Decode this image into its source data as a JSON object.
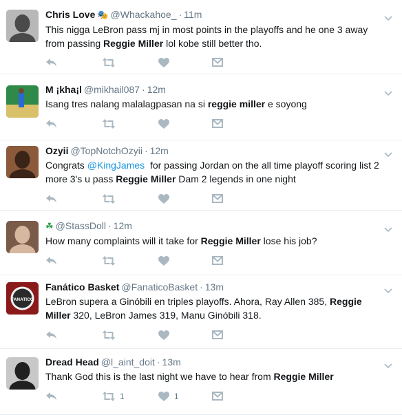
{
  "tweets": [
    {
      "fullname": "Chris Love",
      "emoji": "🎭",
      "username": "@Whackahoe_",
      "time": "11m",
      "segments": [
        {
          "t": "This nigga LeBron pass mj in most points in the playoffs and he one 3 away from passing "
        },
        {
          "t": "Reggie Miller",
          "b": true
        },
        {
          "t": " lol kobe still better tho."
        }
      ],
      "retweets": "",
      "likes": "",
      "avatar_colors": [
        "#4a4a4a",
        "#b8b8b8"
      ]
    },
    {
      "fullname": "M ¡kha¡l",
      "emoji": "",
      "username": "@mikhail087",
      "time": "12m",
      "segments": [
        {
          "t": "Isang tres nalang malalagpasan na si "
        },
        {
          "t": "reggie miller",
          "b": true
        },
        {
          "t": " e soyong"
        }
      ],
      "retweets": "",
      "likes": "",
      "avatar_colors": [
        "#2f8a4a",
        "#d9c16a"
      ]
    },
    {
      "fullname": "Ozyii",
      "emoji": "",
      "username": "@TopNotchOzyii",
      "time": "12m",
      "segments": [
        {
          "t": "Congrats "
        },
        {
          "t": "@KingJames",
          "m": true
        },
        {
          "t": "  for passing Jordan on the all time playoff scoring list 2 more 3's u pass "
        },
        {
          "t": "Reggie Miller",
          "b": true
        },
        {
          "t": " Dam 2 legends in one night"
        }
      ],
      "retweets": "",
      "likes": "",
      "avatar_colors": [
        "#3a2418",
        "#8a5a3a"
      ]
    },
    {
      "fullname": "",
      "emoji": "☘",
      "username": "@StassDoll",
      "time": "12m",
      "segments": [
        {
          "t": "How many complaints will it take for "
        },
        {
          "t": "Reggie Miller",
          "b": true
        },
        {
          "t": " lose his job?"
        }
      ],
      "retweets": "",
      "likes": "",
      "avatar_colors": [
        "#d6b8a0",
        "#7a5a48"
      ]
    },
    {
      "fullname": "Fanático Basket",
      "emoji": "",
      "username": "@FanaticoBasket",
      "time": "13m",
      "segments": [
        {
          "t": "LeBron supera a Ginóbili en triples playoffs. Ahora, Ray Allen 385, "
        },
        {
          "t": "Reggie Miller",
          "b": true
        },
        {
          "t": " 320, LeBron James 319, Manu Ginóbili 318."
        }
      ],
      "retweets": "",
      "likes": "",
      "avatar_colors": [
        "#8a1a1a",
        "#2a2a2a"
      ],
      "avatar_text": "FANATICO"
    },
    {
      "fullname": "Dread Head",
      "emoji": "",
      "username": "@l_aint_doit",
      "time": "13m",
      "segments": [
        {
          "t": "Thank God this is the last night we have to hear from "
        },
        {
          "t": "Reggie Miller",
          "b": true
        }
      ],
      "retweets": "1",
      "likes": "1",
      "avatar_colors": [
        "#202020",
        "#c8c8c8"
      ]
    }
  ],
  "colors": {
    "action_icon": "#aab8c2",
    "secondary_text": "#657786",
    "mention": "#1b95e0",
    "divider": "#e6ecf0"
  },
  "icons": {
    "reply": "reply-icon",
    "retweet": "retweet-icon",
    "like": "heart-icon",
    "dm": "direct-message-icon",
    "caret": "chevron-down-icon"
  }
}
